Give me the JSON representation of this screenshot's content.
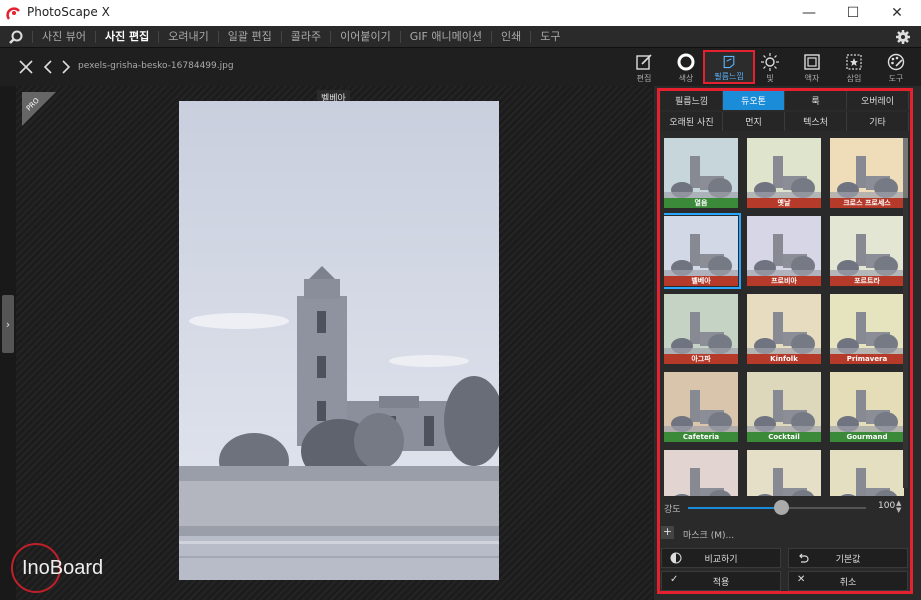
{
  "window": {
    "title": "PhotoScape X",
    "minimize": "—",
    "maximize": "☐",
    "close": "✕"
  },
  "menu": [
    "사진 뷰어",
    "사진 편집",
    "오려내기",
    "일괄 편집",
    "콜라주",
    "이어붙이기",
    "GIF 애니메이션",
    "인쇄",
    "도구"
  ],
  "menu_active": "사진 편집",
  "file_name": "pexels-grisha-besko-16784499.jpg",
  "tools": [
    {
      "name": "edit",
      "label": "편집"
    },
    {
      "name": "color",
      "label": "색상"
    },
    {
      "name": "film",
      "label": "필름느낌"
    },
    {
      "name": "light",
      "label": "빛"
    },
    {
      "name": "frame",
      "label": "액자"
    },
    {
      "name": "insert",
      "label": "삽입"
    },
    {
      "name": "tools",
      "label": "도구"
    }
  ],
  "photo_label": "벨베아",
  "tabs_row1": [
    "필름느낌",
    "듀오톤",
    "룩",
    "오버레이"
  ],
  "tabs_row2": [
    "오래된 사진",
    "먼지",
    "텍스처",
    "기타"
  ],
  "active_tab": "듀오톤",
  "thumbnails": [
    {
      "label": "열음",
      "tint": "#c7d6da",
      "bar": "#3a8a3a"
    },
    {
      "label": "옛날",
      "tint": "#dfe4cc",
      "bar": "#b53a2a"
    },
    {
      "label": "크로스 프로세스",
      "tint": "#efdcb8",
      "bar": "#b53a2a"
    },
    {
      "label": "벨베아",
      "tint": "#d3d8e6",
      "bar": "#b53a2a",
      "selected": true
    },
    {
      "label": "프로비아",
      "tint": "#d6d6e6",
      "bar": "#b53a2a"
    },
    {
      "label": "포르트라",
      "tint": "#e2e6d2",
      "bar": "#b53a2a"
    },
    {
      "label": "아그파",
      "tint": "#c4d3c4",
      "bar": "#b53a2a"
    },
    {
      "label": "Kinfolk",
      "tint": "#e8dcc0",
      "bar": "#b53a2a"
    },
    {
      "label": "Primavera",
      "tint": "#e6e4bf",
      "bar": "#b53a2a"
    },
    {
      "label": "Cafeteria",
      "tint": "#d9c4ac",
      "bar": "#3a8a3a"
    },
    {
      "label": "Cocktail",
      "tint": "#ddd8bc",
      "bar": "#3a8a3a"
    },
    {
      "label": "Gourmand",
      "tint": "#e5dcb8",
      "bar": "#3a8a3a"
    },
    {
      "label": "",
      "tint": "#e2d4d0",
      "bar": ""
    },
    {
      "label": "",
      "tint": "#e6dfc8",
      "bar": ""
    },
    {
      "label": "",
      "tint": "#e3dfc0",
      "bar": ""
    }
  ],
  "strength": {
    "label": "강도",
    "value": 100,
    "fraction": 0.5
  },
  "mask_label": "마스크 (M)...",
  "compare_label": "비교하기",
  "reset_label": "기본값",
  "apply_label": "적용",
  "cancel_label": "취소",
  "colors": {
    "accent": "#1a8cd8",
    "highlight_red": "#e5202f"
  }
}
